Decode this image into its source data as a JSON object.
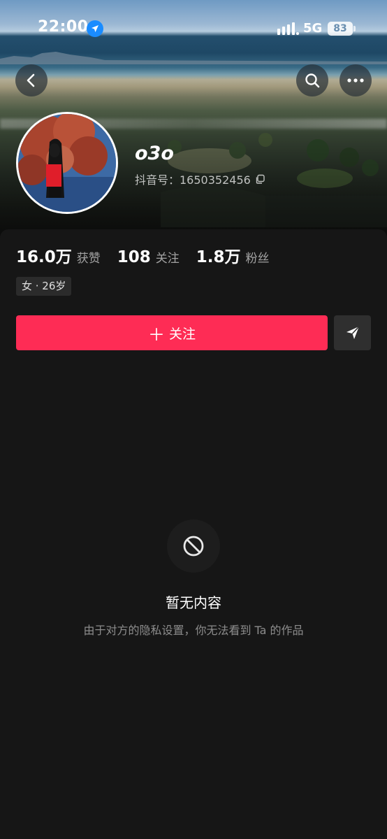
{
  "status_bar": {
    "time": "22:00",
    "network": "5G",
    "battery": "83"
  },
  "header": {
    "back_icon": "chevron-left-icon",
    "search_icon": "search-icon",
    "more_icon": "more-dots-icon"
  },
  "profile": {
    "username": "o3o",
    "douyin_id": "抖音号：1650352456",
    "stats": [
      {
        "value": "16.0万",
        "label": "获赞"
      },
      {
        "value": "108",
        "label": "关注"
      },
      {
        "value": "1.8万",
        "label": "粉丝"
      }
    ],
    "tag": "女 · 26岁"
  },
  "actions": {
    "follow_label": "关注",
    "follow_color": "#fe2c55",
    "share_icon": "send-icon"
  },
  "empty_state": {
    "icon": "block-icon",
    "title": "暂无内容",
    "description": "由于对方的隐私设置，你无法看到 Ta 的作品"
  }
}
